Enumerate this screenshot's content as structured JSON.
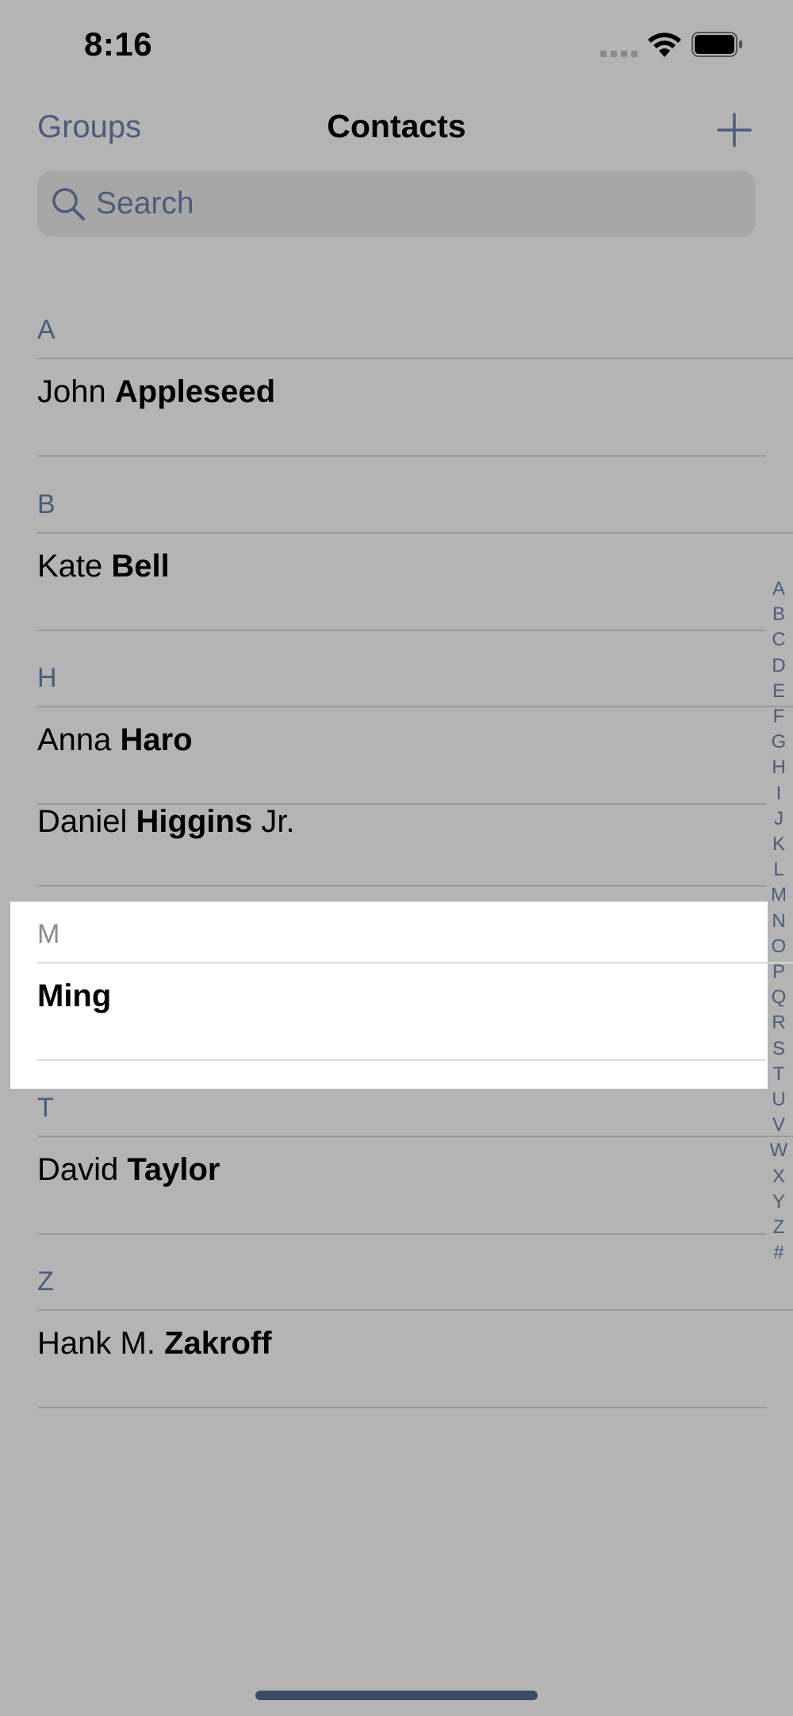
{
  "status_bar": {
    "time": "8:16"
  },
  "nav": {
    "left_label": "Groups",
    "title": "Contacts",
    "add_icon": "plus-icon"
  },
  "search": {
    "placeholder": "Search",
    "icon": "magnifying-glass-icon"
  },
  "sections": [
    {
      "letter": "A",
      "contacts": [
        {
          "first": "John",
          "last": "Appleseed",
          "suffix": ""
        }
      ]
    },
    {
      "letter": "B",
      "contacts": [
        {
          "first": "Kate",
          "last": "Bell",
          "suffix": ""
        }
      ]
    },
    {
      "letter": "H",
      "contacts": [
        {
          "first": "Anna",
          "last": "Haro",
          "suffix": ""
        },
        {
          "first": "Daniel",
          "last": "Higgins",
          "suffix": "Jr."
        }
      ]
    },
    {
      "letter": "M",
      "highlighted": true,
      "contacts": [
        {
          "first": "",
          "last": "Ming",
          "suffix": ""
        }
      ]
    },
    {
      "letter": "T",
      "contacts": [
        {
          "first": "David",
          "last": "Taylor",
          "suffix": ""
        }
      ]
    },
    {
      "letter": "Z",
      "contacts": [
        {
          "first": "Hank M.",
          "last": "Zakroff",
          "suffix": ""
        }
      ]
    }
  ],
  "index_letters": [
    "A",
    "B",
    "C",
    "D",
    "E",
    "F",
    "G",
    "H",
    "I",
    "J",
    "K",
    "L",
    "M",
    "N",
    "O",
    "P",
    "Q",
    "R",
    "S",
    "T",
    "U",
    "V",
    "W",
    "X",
    "Y",
    "Z",
    "#"
  ],
  "colors": {
    "background": "#b4b4b4",
    "accent": "#4b5c7b",
    "highlight": "#ffffff"
  }
}
